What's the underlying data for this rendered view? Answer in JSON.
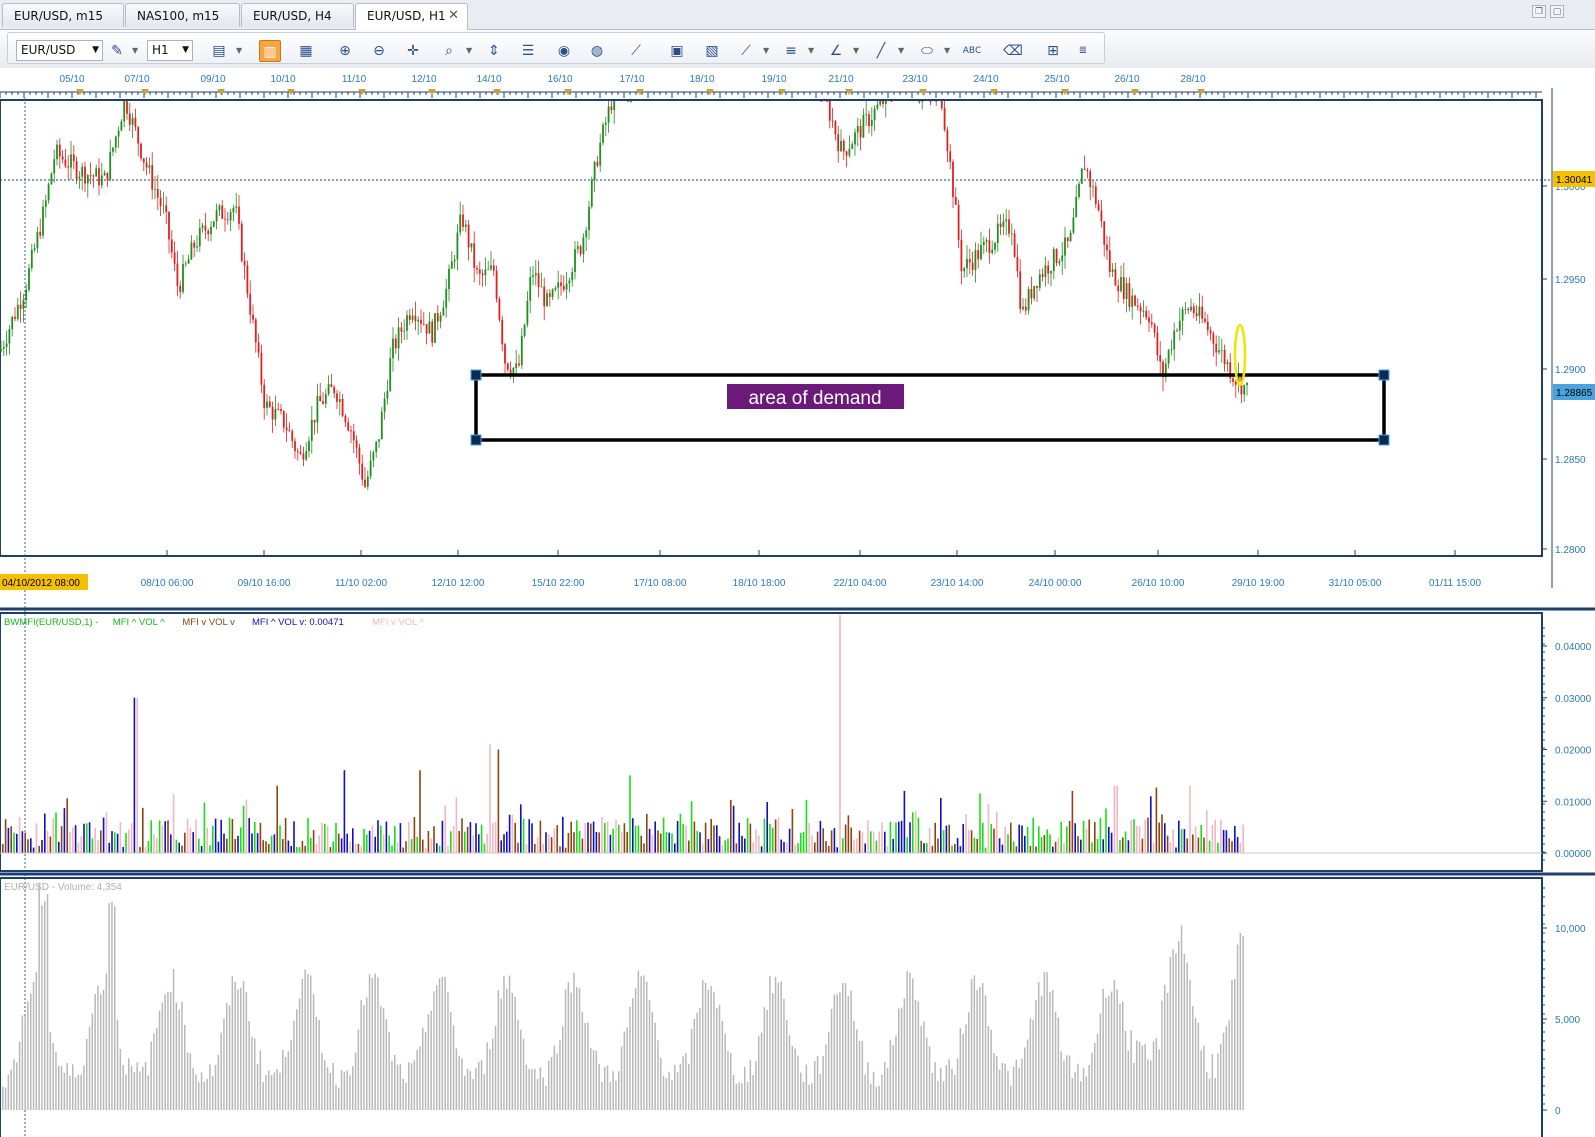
{
  "tabs": [
    {
      "label": "EUR/USD, m15",
      "active": false
    },
    {
      "label": "NAS100, m15",
      "active": false
    },
    {
      "label": "EUR/USD, H4",
      "active": false
    },
    {
      "label": "EUR/USD, H1",
      "active": true
    }
  ],
  "toolbar": {
    "symbol": "EUR/USD",
    "timeframe": "H1",
    "icons": [
      "chart-type-icon",
      "zoom-cursor-icon",
      "bar-chart-icon",
      "indicators-icon",
      "zoom-in-icon",
      "zoom-out-icon",
      "crosshair-icon",
      "zoom-area-icon",
      "scale-icon",
      "properties-icon",
      "eye-icon",
      "globe-icon",
      "ruler-icon",
      "screenshot-icon",
      "template-icon",
      "trend-tools-icon",
      "horizontal-lines-icon",
      "fibonacci-icon",
      "line-draw-icon",
      "ellipse-icon",
      "text-label-icon",
      "eraser-icon",
      "objects-tree-icon",
      "more-icon"
    ]
  },
  "price_chart": {
    "top_dates": [
      "05/10",
      "07/10",
      "09/10",
      "10/10",
      "11/10",
      "12/10",
      "14/10",
      "16/10",
      "17/10",
      "18/10",
      "19/10",
      "21/10",
      "23/10",
      "24/10",
      "25/10",
      "26/10",
      "28/10"
    ],
    "price_ticks": [
      "1.3000",
      "1.2950",
      "1.2900",
      "1.2850",
      "1.2800"
    ],
    "current_price_label": "1.30041",
    "bid_label": "1.28865",
    "annotation": "area of demand",
    "time_axis_labels": [
      "08/10 06:00",
      "09/10 16:00",
      "11/10 02:00",
      "12/10 12:00",
      "15/10 22:00",
      "17/10 08:00",
      "18/10 18:00",
      "22/10 04:00",
      "23/10 14:00",
      "24/10 00:00",
      "26/10 10:00",
      "29/10 19:00",
      "31/10 05:00",
      "01/11 15:00"
    ],
    "crosshair_time": "04/10/2012 08:00",
    "colors": {
      "bull": "#1e8f1e",
      "bear": "#e02020",
      "zone": "#000000",
      "label_bg": "#6b1a7a",
      "highlight": "#f0e600",
      "price_tag": "#f5c000",
      "bid_tag": "#4aa3df"
    }
  },
  "bwmfi": {
    "legend": [
      {
        "text": "BWMFI(EUR/USD,1) -",
        "color": "#17b817"
      },
      {
        "text": "MFI ^ VOL ^",
        "color": "#17b817"
      },
      {
        "text": "MFI v VOL v",
        "color": "#8b4513"
      },
      {
        "text": "MFI ^ VOL v: 0.00471",
        "color": "#1010c0"
      },
      {
        "text": "MFI v VOL ^",
        "color": "#f2b8c2"
      }
    ],
    "y_ticks": [
      "0.04000",
      "0.03000",
      "0.02000",
      "0.01000",
      "0.00000"
    ]
  },
  "volume": {
    "legend": "EUR/USD - Volume: 4,354",
    "y_ticks": [
      "10,000",
      "5,000",
      "0"
    ]
  }
}
